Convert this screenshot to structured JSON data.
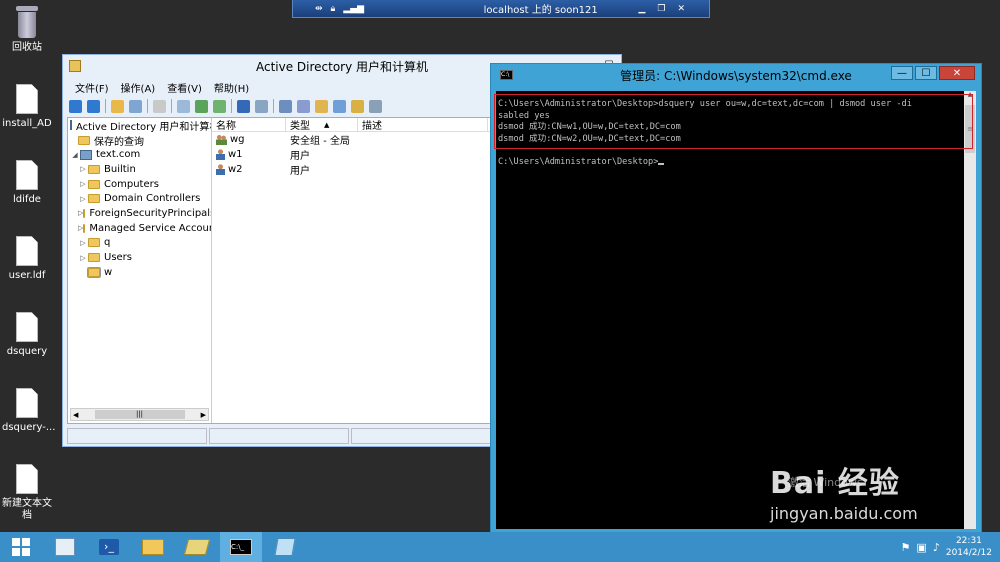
{
  "rdp_bar": {
    "title": "localhost 上的 soon121"
  },
  "desktop_icons": [
    {
      "label": "回收站"
    },
    {
      "label": "install_AD"
    },
    {
      "label": "ldifde"
    },
    {
      "label": "user.ldf"
    },
    {
      "label": "dsquery"
    },
    {
      "label": "dsquery-..."
    },
    {
      "label": "新建文本文档"
    }
  ],
  "ad_window": {
    "title": "Active Directory 用户和计算机",
    "menu": [
      "文件(F)",
      "操作(A)",
      "查看(V)",
      "帮助(H)"
    ],
    "tree": {
      "root": "Active Directory 用户和计算机 [s",
      "saved_queries": "保存的查询",
      "domain": "text.com",
      "items": [
        "Builtin",
        "Computers",
        "Domain Controllers",
        "ForeignSecurityPrincipals",
        "Managed Service Accour",
        "q",
        "Users",
        "w"
      ]
    },
    "columns": {
      "name": "名称",
      "type": "类型",
      "description": "描述"
    },
    "rows": [
      {
        "name": "wg",
        "type": "安全组 - 全局",
        "kind": "group-icon"
      },
      {
        "name": "w1",
        "type": "用户",
        "kind": "user-icon"
      },
      {
        "name": "w2",
        "type": "用户",
        "kind": "user-icon"
      }
    ]
  },
  "cmd_window": {
    "title": "管理员: C:\\Windows\\system32\\cmd.exe",
    "lines": [
      "C:\\Users\\Administrator\\Desktop>dsquery user ou=w,dc=text,dc=com | dsmod user -di",
      "sabled yes",
      "dsmod 成功:CN=w1,OU=w,DC=text,DC=com",
      "dsmod 成功:CN=w2,OU=w,DC=text,DC=com",
      "",
      "C:\\Users\\Administrator\\Desktop>"
    ]
  },
  "watermark": {
    "logo": "Bai 经验",
    "url": "jingyan.baidu.com",
    "activate": "激活 Windows"
  },
  "taskbar": {
    "time": "22:31",
    "date": "2014/2/12"
  },
  "colors": {
    "taskbar": "#3a8fc9",
    "cmd_frame": "#3fa3d6",
    "highlight": "#d0232a"
  }
}
